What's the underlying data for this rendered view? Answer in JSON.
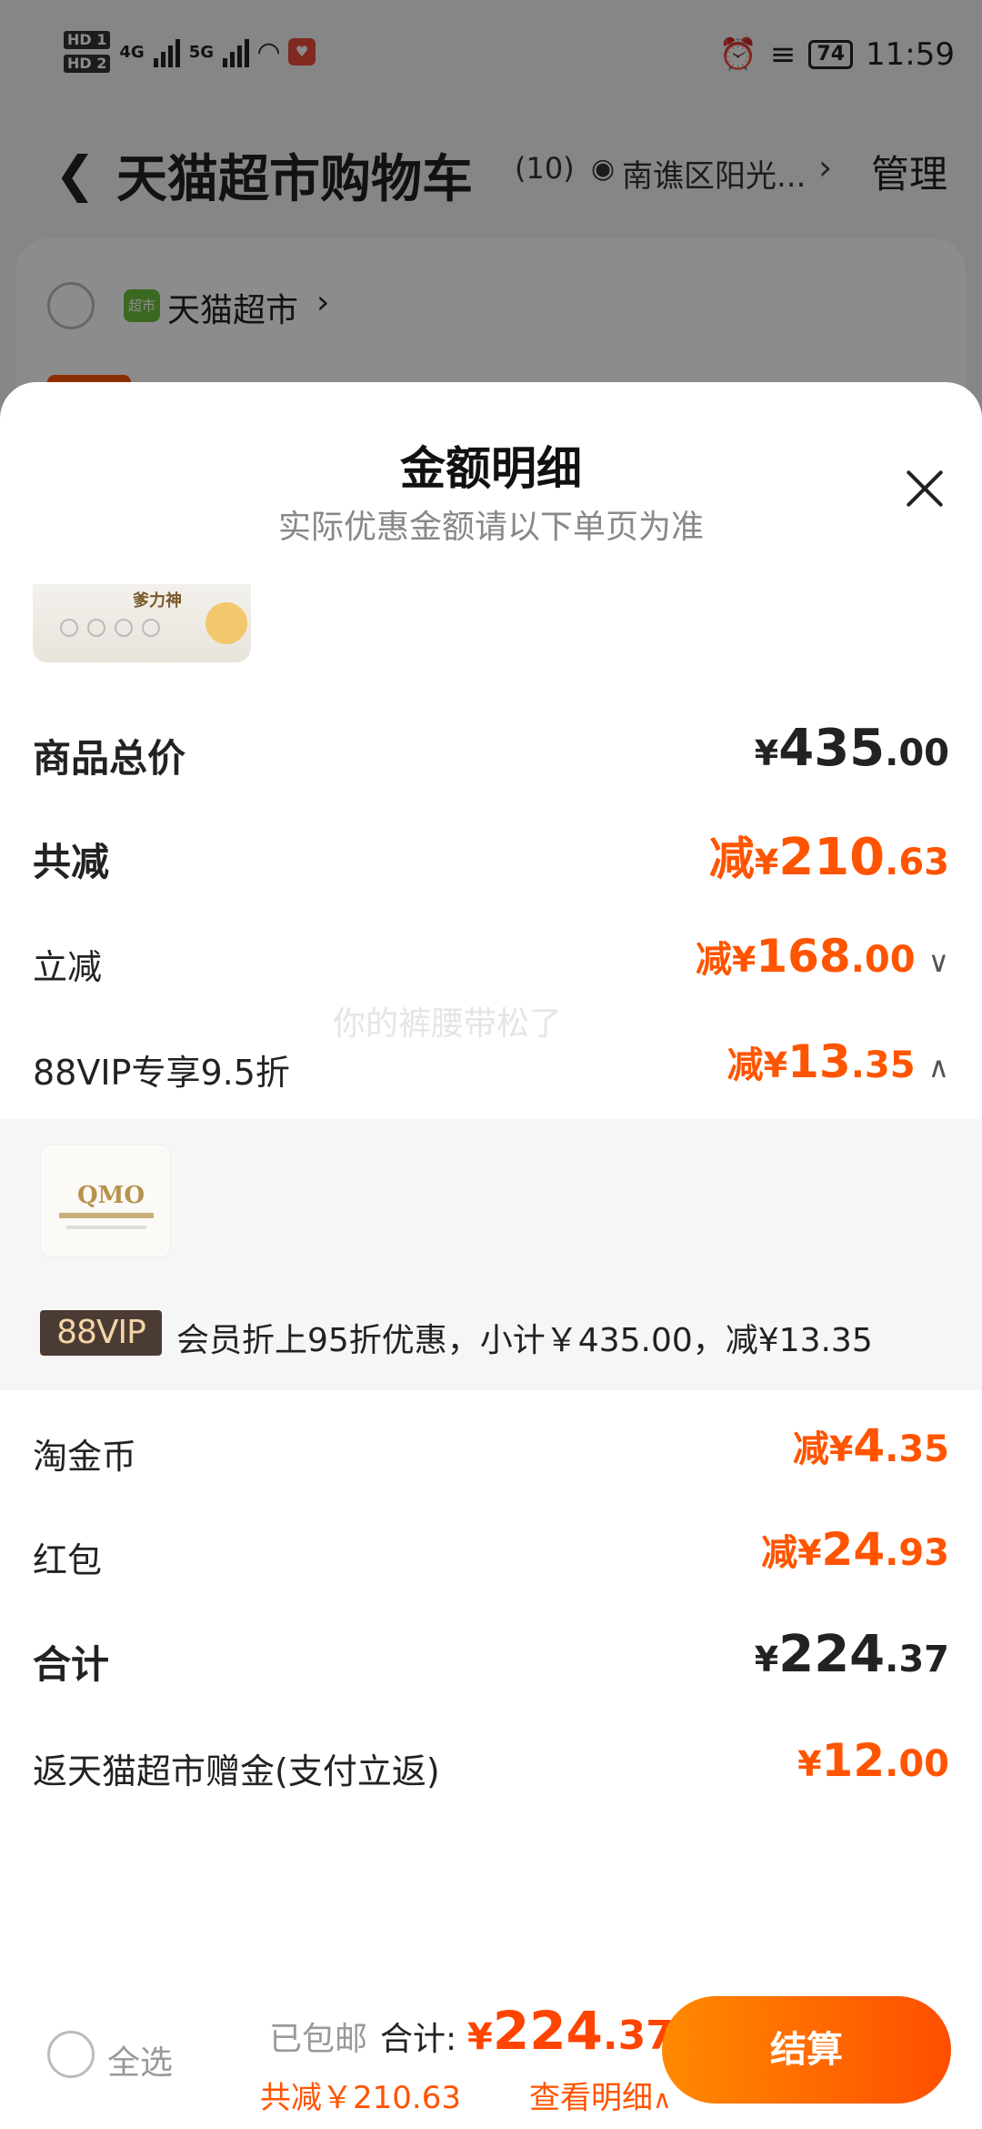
{
  "status_bar": {
    "hd1": "HD 1",
    "hd2": "HD 2",
    "net1": "4G",
    "net2": "5G",
    "battery": "74",
    "time": "11:59"
  },
  "nav": {
    "title": "天猫超市购物车",
    "count": "(10)",
    "location": "南谯区阳光...",
    "manage": "管理"
  },
  "store": {
    "name": "天猫超市",
    "logo_text": "超市"
  },
  "sheet": {
    "title": "金额明细",
    "subtitle": "实际优惠金额请以下单页为准",
    "product1_brand": "爹力神",
    "product2_brand": "QMO",
    "watermark": "你的裤腰带松了",
    "rows": {
      "total_price": {
        "label": "商品总价",
        "cur": "¥",
        "int": "435",
        "dec": ".00"
      },
      "total_discount": {
        "label": "共减",
        "prefix": "减",
        "cur": "¥",
        "int": "210",
        "dec": ".63"
      },
      "instant_discount": {
        "label": "立减",
        "prefix": "减",
        "cur": "¥",
        "int": "168",
        "dec": ".00"
      },
      "vip_discount": {
        "label": "88VIP专享9.5折",
        "prefix": "减",
        "cur": "¥",
        "int": "13",
        "dec": ".35"
      },
      "coins": {
        "label": "淘金币",
        "prefix": "减",
        "cur": "¥",
        "int": "4",
        "dec": ".35"
      },
      "red_packet": {
        "label": "红包",
        "prefix": "减",
        "cur": "¥",
        "int": "24",
        "dec": ".93"
      },
      "sum": {
        "label": "合计",
        "cur": "¥",
        "int": "224",
        "dec": ".37"
      },
      "rebate": {
        "label": "返天猫超市赠金(支付立返)",
        "cur": "¥",
        "int": "12",
        "dec": ".00"
      }
    },
    "vip": {
      "badge": "88VIP",
      "description": "会员折上95折优惠，小计￥435.00，减¥13.35"
    }
  },
  "bottom_bar": {
    "select_all": "全选",
    "free_shipping": "已包邮",
    "total_label": "合计:",
    "total_cur": "¥",
    "total_int": "224",
    "total_dec": ".37",
    "saved": "共减￥210.63",
    "detail_link": "查看明细",
    "checkout": "结算"
  },
  "colors": {
    "accent": "#ff5400",
    "checkout_start": "#ff8a00",
    "checkout_end": "#ff4e00",
    "vip_badge_bg": "#4a3b33",
    "vip_badge_text": "#f3d5a6"
  }
}
